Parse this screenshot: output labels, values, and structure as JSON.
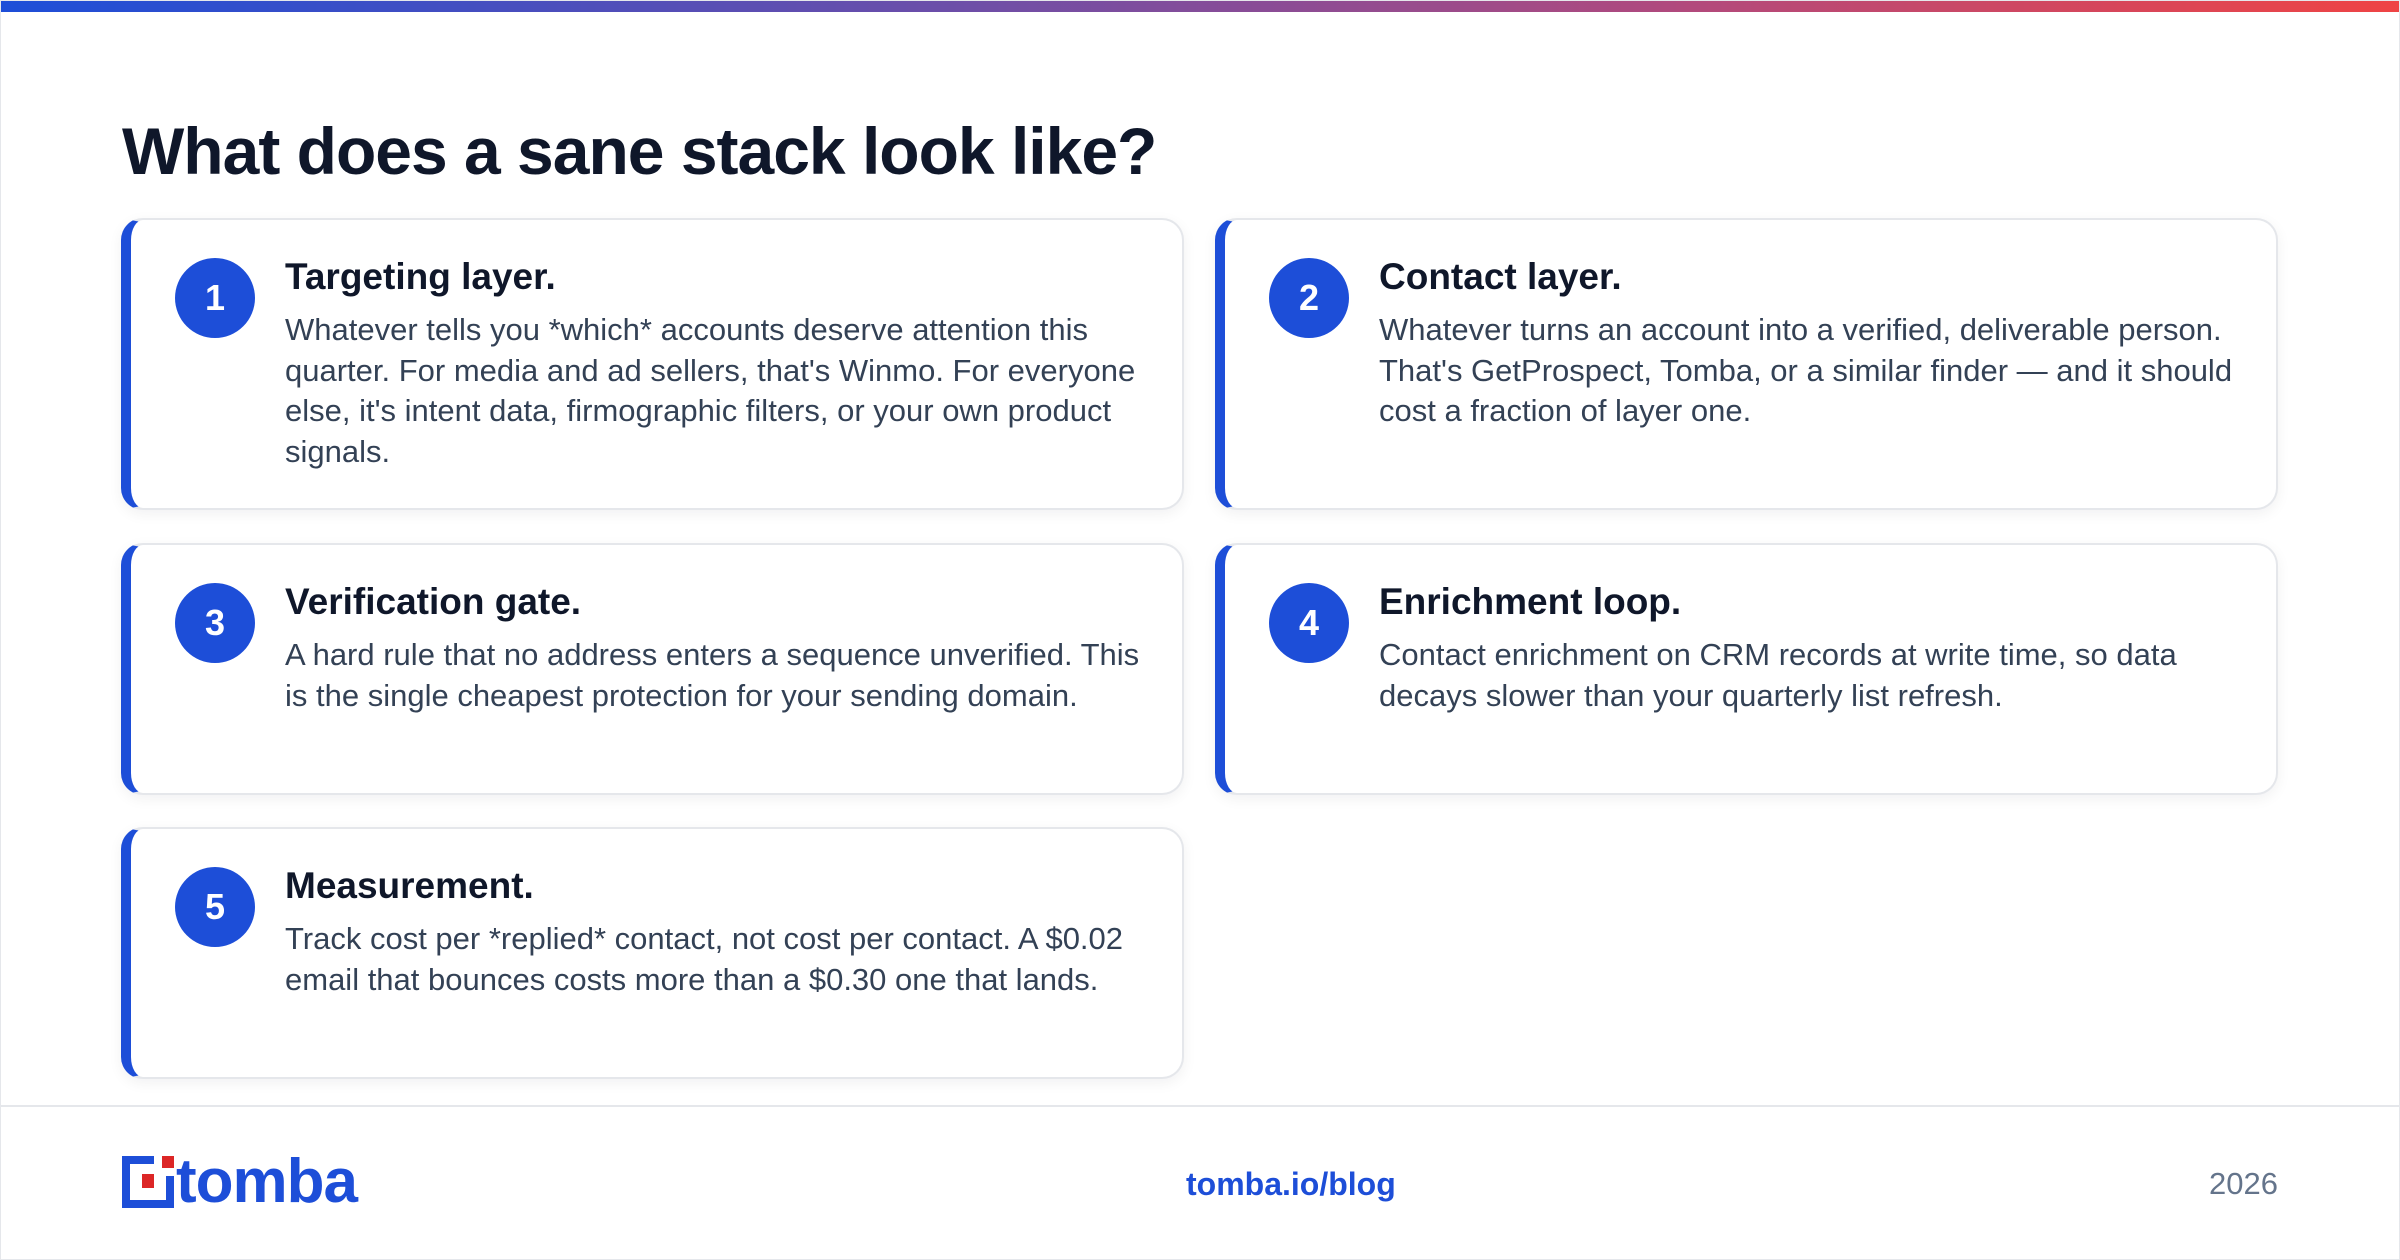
{
  "brand": {
    "name": "tomba",
    "accent_color": "#1d4ed8",
    "secondary_color": "#dc2626",
    "gradient": [
      "#1d4ed8",
      "#ef4444"
    ]
  },
  "title": "What does a sane stack look like?",
  "cards": [
    {
      "number": "1",
      "heading": "Targeting layer.",
      "body": "Whatever tells you *which* accounts deserve attention this quarter. For media and ad sellers, that's Winmo. For everyone else, it's intent data, firmographic filters, or your own product signals."
    },
    {
      "number": "2",
      "heading": "Contact layer.",
      "body": "Whatever turns an account into a verified, deliverable person. That's GetProspect, Tomba, or a similar finder — and it should cost a fraction of layer one."
    },
    {
      "number": "3",
      "heading": "Verification gate.",
      "body": "A hard rule that no address enters a sequence unverified. This is the single cheapest protection for your sending domain."
    },
    {
      "number": "4",
      "heading": "Enrichment loop.",
      "body": "Contact enrichment on CRM records at write time, so data decays slower than your quarterly list refresh."
    },
    {
      "number": "5",
      "heading": "Measurement.",
      "body": "Track cost per *replied* contact, not cost per contact. A $0.02 email that bounces costs more than a $0.30 one that lands."
    }
  ],
  "footer": {
    "logo_text": "tomba",
    "url": "tomba.io/blog",
    "year": "2026"
  }
}
